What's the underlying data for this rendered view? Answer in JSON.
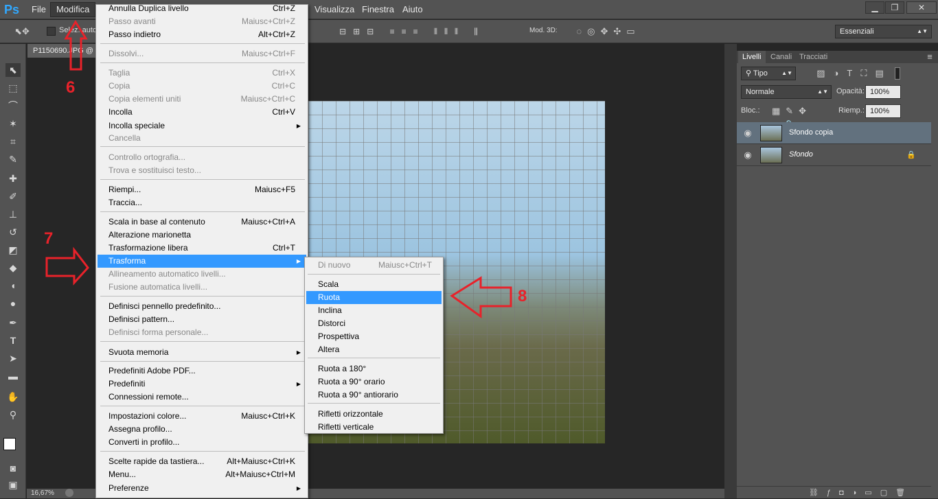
{
  "app": {
    "logo": "Ps"
  },
  "menubar": {
    "items": [
      "File",
      "Modifica",
      "Visualizza",
      "Finestra",
      "Aiuto"
    ]
  },
  "window_controls": {
    "minimize": "▁",
    "restore": "❐",
    "close": "✕"
  },
  "options_bar": {
    "auto_select_label": "Selez. autom.:",
    "mode3d_label": "Mod. 3D:",
    "workspace": "Essenziali"
  },
  "document": {
    "tab_title": "P1150690.JPG @",
    "zoom": "16,67%"
  },
  "menu_modifica": {
    "items": [
      {
        "label": "Annulla Duplica livello",
        "shortcut": "Ctrl+Z",
        "disabled": false
      },
      {
        "label": "Passo avanti",
        "shortcut": "Maiusc+Ctrl+Z",
        "disabled": true
      },
      {
        "label": "Passo indietro",
        "shortcut": "Alt+Ctrl+Z",
        "disabled": false
      },
      {
        "label": "Dissolvi...",
        "shortcut": "Maiusc+Ctrl+F",
        "disabled": true
      },
      {
        "label": "Taglia",
        "shortcut": "Ctrl+X",
        "disabled": true
      },
      {
        "label": "Copia",
        "shortcut": "Ctrl+C",
        "disabled": true
      },
      {
        "label": "Copia elementi uniti",
        "shortcut": "Maiusc+Ctrl+C",
        "disabled": true
      },
      {
        "label": "Incolla",
        "shortcut": "Ctrl+V",
        "disabled": false
      },
      {
        "label": "Incolla speciale",
        "shortcut": "",
        "disabled": false
      },
      {
        "label": "Cancella",
        "shortcut": "",
        "disabled": true
      },
      {
        "label": "Controllo ortografia...",
        "shortcut": "",
        "disabled": true
      },
      {
        "label": "Trova e sostituisci testo...",
        "shortcut": "",
        "disabled": true
      },
      {
        "label": "Riempi...",
        "shortcut": "Maiusc+F5",
        "disabled": false
      },
      {
        "label": "Traccia...",
        "shortcut": "",
        "disabled": false
      },
      {
        "label": "Scala in base al contenuto",
        "shortcut": "Maiusc+Ctrl+A",
        "disabled": false
      },
      {
        "label": "Alterazione marionetta",
        "shortcut": "",
        "disabled": false
      },
      {
        "label": "Trasformazione libera",
        "shortcut": "Ctrl+T",
        "disabled": false
      },
      {
        "label": "Trasforma",
        "shortcut": "",
        "disabled": false
      },
      {
        "label": "Allineamento automatico livelli...",
        "shortcut": "",
        "disabled": true
      },
      {
        "label": "Fusione automatica livelli...",
        "shortcut": "",
        "disabled": true
      },
      {
        "label": "Definisci pennello predefinito...",
        "shortcut": "",
        "disabled": false
      },
      {
        "label": "Definisci pattern...",
        "shortcut": "",
        "disabled": false
      },
      {
        "label": "Definisci forma personale...",
        "shortcut": "",
        "disabled": true
      },
      {
        "label": "Svuota memoria",
        "shortcut": "",
        "disabled": false
      },
      {
        "label": "Predefiniti Adobe PDF...",
        "shortcut": "",
        "disabled": false
      },
      {
        "label": "Predefiniti",
        "shortcut": "",
        "disabled": false
      },
      {
        "label": "Connessioni remote...",
        "shortcut": "",
        "disabled": false
      },
      {
        "label": "Impostazioni colore...",
        "shortcut": "Maiusc+Ctrl+K",
        "disabled": false
      },
      {
        "label": "Assegna profilo...",
        "shortcut": "",
        "disabled": false
      },
      {
        "label": "Converti in profilo...",
        "shortcut": "",
        "disabled": false
      },
      {
        "label": "Scelte rapide da tastiera...",
        "shortcut": "Alt+Maiusc+Ctrl+K",
        "disabled": false
      },
      {
        "label": "Menu...",
        "shortcut": "Alt+Maiusc+Ctrl+M",
        "disabled": false
      },
      {
        "label": "Preferenze",
        "shortcut": "",
        "disabled": false
      }
    ],
    "submenu_arrow": "▶"
  },
  "submenu_trasforma": {
    "items": [
      {
        "label": "Di nuovo",
        "shortcut": "Maiusc+Ctrl+T",
        "disabled": true
      },
      {
        "label": "Scala",
        "shortcut": ""
      },
      {
        "label": "Ruota",
        "shortcut": ""
      },
      {
        "label": "Inclina",
        "shortcut": ""
      },
      {
        "label": "Distorci",
        "shortcut": ""
      },
      {
        "label": "Prospettiva",
        "shortcut": ""
      },
      {
        "label": "Altera",
        "shortcut": ""
      },
      {
        "label": "Ruota a 180°",
        "shortcut": ""
      },
      {
        "label": "Ruota a 90° orario",
        "shortcut": ""
      },
      {
        "label": "Ruota a 90° antiorario",
        "shortcut": ""
      },
      {
        "label": "Rifletti orizzontale",
        "shortcut": ""
      },
      {
        "label": "Rifletti verticale",
        "shortcut": ""
      }
    ]
  },
  "layers_panel": {
    "tabs": [
      "Livelli",
      "Canali",
      "Tracciati"
    ],
    "filter": "Tipo",
    "blend_mode": "Normale",
    "opacity_label": "Opacità:",
    "opacity": "100%",
    "lock_label": "Bloc.:",
    "fill_label": "Riemp.:",
    "fill": "100%",
    "layers": [
      "Sfondo copia",
      "Sfondo"
    ]
  },
  "annotations": {
    "a6": "6",
    "a7": "7",
    "a8": "8"
  },
  "colors": {
    "accent": "#3399ff",
    "annotation": "#e8222a",
    "panel": "#535353"
  }
}
